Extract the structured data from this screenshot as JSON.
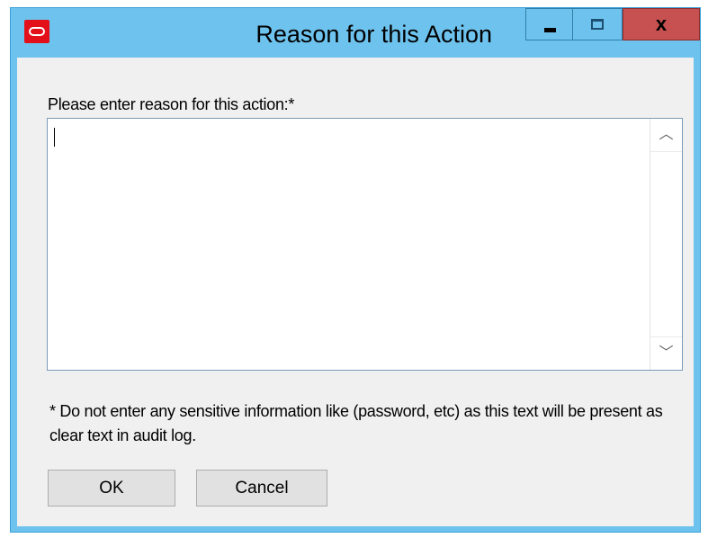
{
  "window": {
    "title": "Reason for this Action",
    "close_glyph": "x",
    "icon": "oracle-logo-icon"
  },
  "form": {
    "reason_label": "Please enter reason for this action:*",
    "reason_value": "",
    "note": "* Do not enter any sensitive information like (password, etc) as this text will be present as clear text in audit log."
  },
  "scrollbar": {
    "up_glyph": "︿",
    "down_glyph": "﹀"
  },
  "buttons": {
    "ok": "OK",
    "cancel": "Cancel"
  },
  "colors": {
    "frame": "#6ec3ee",
    "close_button": "#c75050",
    "dialog_background": "#f0f0f0",
    "app_icon": "#e3101a"
  }
}
